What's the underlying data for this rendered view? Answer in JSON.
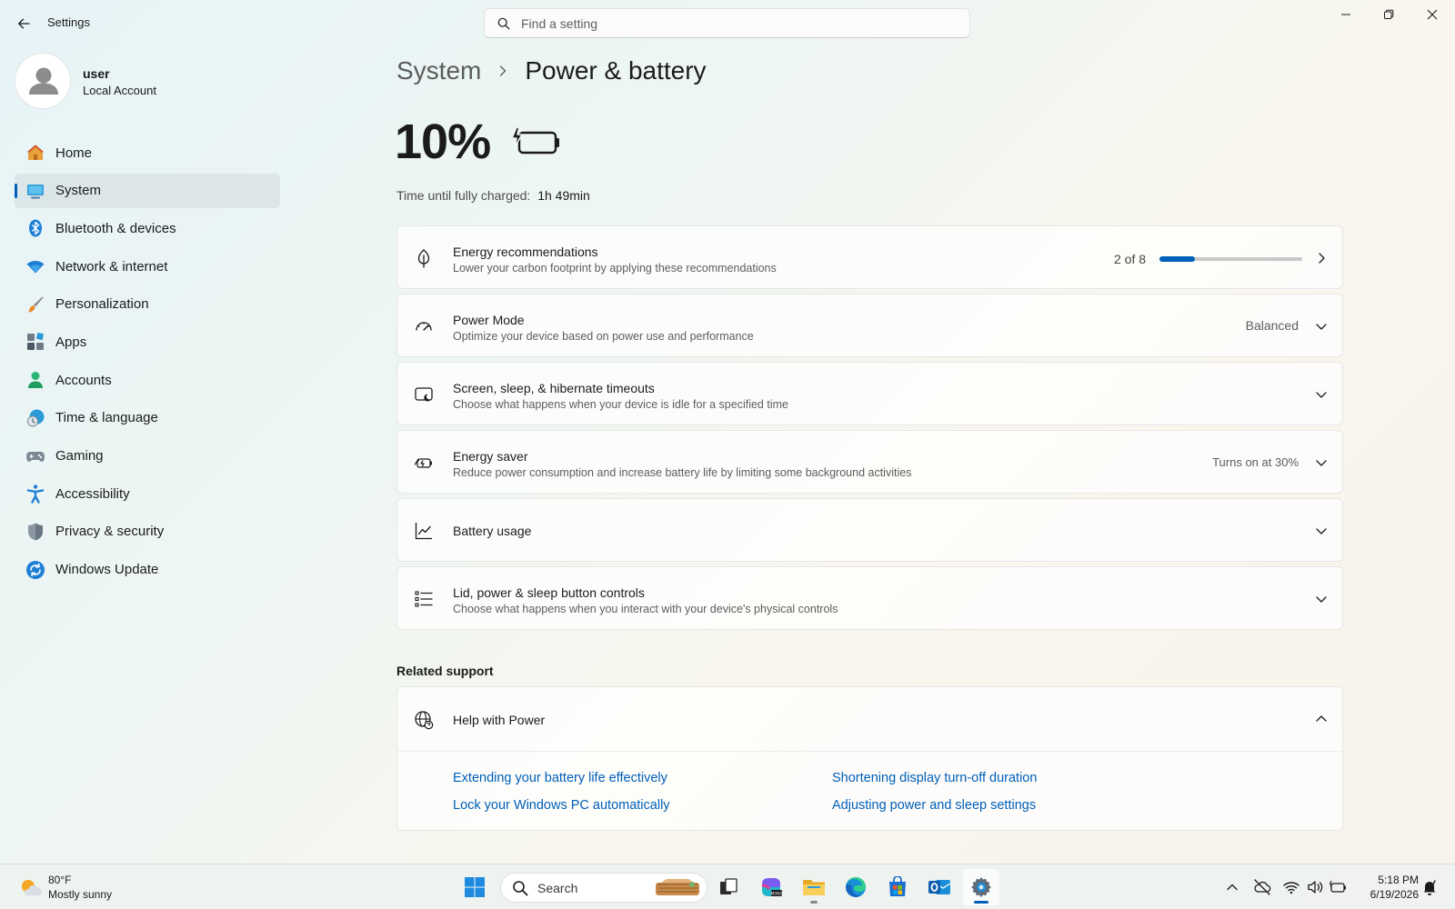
{
  "window": {
    "app_title": "Settings",
    "search_placeholder": "Find a setting"
  },
  "profile": {
    "name": "user",
    "account_type": "Local Account"
  },
  "sidebar": {
    "items": [
      {
        "label": "Home",
        "icon": "home-icon"
      },
      {
        "label": "System",
        "icon": "system-icon",
        "active": true
      },
      {
        "label": "Bluetooth & devices",
        "icon": "bluetooth-icon"
      },
      {
        "label": "Network & internet",
        "icon": "wifi-icon"
      },
      {
        "label": "Personalization",
        "icon": "paintbrush-icon"
      },
      {
        "label": "Apps",
        "icon": "apps-icon"
      },
      {
        "label": "Accounts",
        "icon": "accounts-icon"
      },
      {
        "label": "Time & language",
        "icon": "clock-globe-icon"
      },
      {
        "label": "Gaming",
        "icon": "gamepad-icon"
      },
      {
        "label": "Accessibility",
        "icon": "accessibility-icon"
      },
      {
        "label": "Privacy & security",
        "icon": "shield-icon"
      },
      {
        "label": "Windows Update",
        "icon": "update-icon"
      }
    ]
  },
  "breadcrumb": {
    "parent": "System",
    "current": "Power & battery"
  },
  "battery": {
    "percent": "10%",
    "charging": true,
    "charge_label": "Time until fully charged:",
    "charge_value": "1h 49min"
  },
  "cards": [
    {
      "title": "Energy recommendations",
      "subtitle": "Lower your carbon footprint by applying these recommendations",
      "icon": "leaf-icon",
      "progress_text": "2 of 8",
      "progress": 0.25,
      "chevron": "chevron-right-icon"
    },
    {
      "title": "Power Mode",
      "subtitle": "Optimize your device based on power use and performance",
      "icon": "gauge-icon",
      "value": "Balanced",
      "chevron": "chevron-down-icon"
    },
    {
      "title": "Screen, sleep, & hibernate timeouts",
      "subtitle": "Choose what happens when your device is idle for a specified time",
      "icon": "screen-sleep-icon",
      "chevron": "chevron-down-icon"
    },
    {
      "title": "Energy saver",
      "subtitle": "Reduce power consumption and increase battery life by limiting some background activities",
      "icon": "energy-saver-icon",
      "value": "Turns on at 30%",
      "chevron": "chevron-down-icon"
    },
    {
      "title": "Battery usage",
      "icon": "chart-line-icon",
      "chevron": "chevron-down-icon"
    },
    {
      "title": "Lid, power & sleep button controls",
      "subtitle": "Choose what happens when you interact with your device's physical controls",
      "icon": "list-icon",
      "chevron": "chevron-down-icon"
    }
  ],
  "related": {
    "heading": "Related support",
    "help_title": "Help with Power",
    "links": [
      "Extending your battery life effectively",
      "Shortening display turn-off duration",
      "Lock your Windows PC automatically",
      "Adjusting power and sleep settings"
    ]
  },
  "taskbar": {
    "weather_temp": "80°F",
    "weather_desc": "Mostly sunny",
    "search_label": "Search",
    "time": "5:18 PM",
    "date": "6/19/2026",
    "accent": "#005fb8"
  }
}
